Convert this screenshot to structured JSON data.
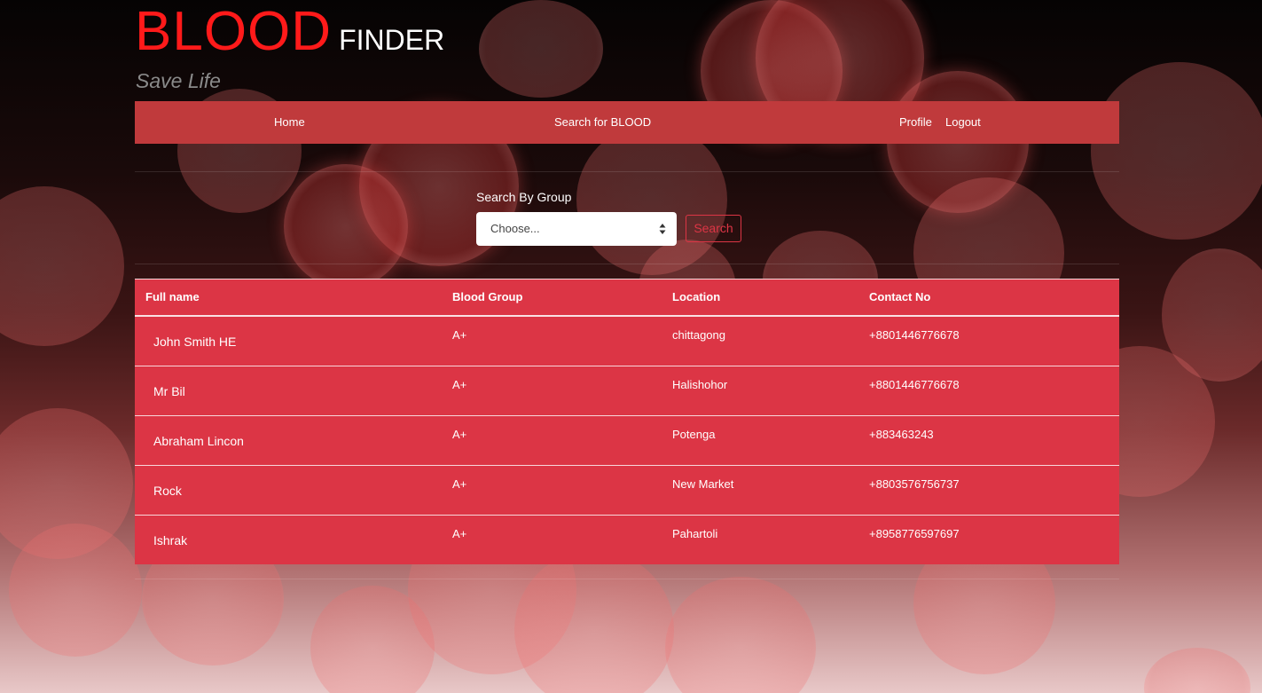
{
  "brand": {
    "title_primary": "BLOOD",
    "title_secondary": "FINDER",
    "tagline": "Save Life"
  },
  "nav": {
    "home": "Home",
    "search": "Search for BLOOD",
    "profile": "Profile",
    "logout": "Logout"
  },
  "search": {
    "label": "Search By Group",
    "select_value": "Choose...",
    "button_label": "Search"
  },
  "table": {
    "headers": [
      "Full name",
      "Blood Group",
      "Location",
      "Contact No"
    ],
    "rows": [
      {
        "name": "John Smith HE",
        "group": "A+",
        "location": "chittagong",
        "contact": "+8801446776678"
      },
      {
        "name": "Mr Bil",
        "group": "A+",
        "location": "Halishohor",
        "contact": "+8801446776678"
      },
      {
        "name": "Abraham Lincon",
        "group": "A+",
        "location": "Potenga",
        "contact": "+883463243"
      },
      {
        "name": "Rock",
        "group": "A+",
        "location": "New Market",
        "contact": "+8803576756737"
      },
      {
        "name": "Ishrak",
        "group": "A+",
        "location": "Pahartoli",
        "contact": "+8958776597697"
      }
    ]
  },
  "colors": {
    "brand_red": "#ff1a1a",
    "navbar": "#c03a3c",
    "table_bg": "#dc3545"
  }
}
